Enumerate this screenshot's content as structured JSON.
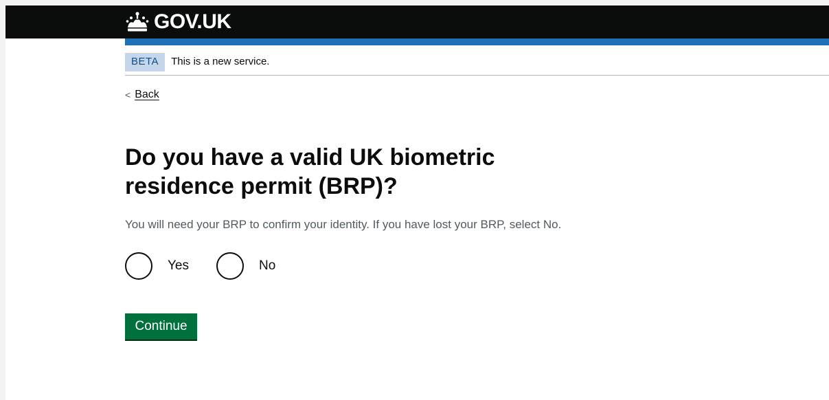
{
  "header": {
    "logo_text": "GOV.UK",
    "logo_icon": "crown-icon"
  },
  "phase_banner": {
    "tag": "BETA",
    "text": "This is a new service."
  },
  "back_link": {
    "label": "Back",
    "icon": "chevron-left-icon"
  },
  "question": {
    "heading": "Do you have a valid UK biometric residence permit (BRP)?",
    "hint": "You will need your BRP to confirm your identity. If you have lost your BRP, select No.",
    "options": [
      {
        "label": "Yes",
        "selected": false
      },
      {
        "label": "No",
        "selected": false
      }
    ]
  },
  "actions": {
    "continue_label": "Continue"
  },
  "colors": {
    "header_bg": "#0b0c0c",
    "brand_blue": "#1d70b8",
    "button_green": "#00703c",
    "phase_tag_bg": "#c5d6ea",
    "hint_text": "#505a5f"
  }
}
